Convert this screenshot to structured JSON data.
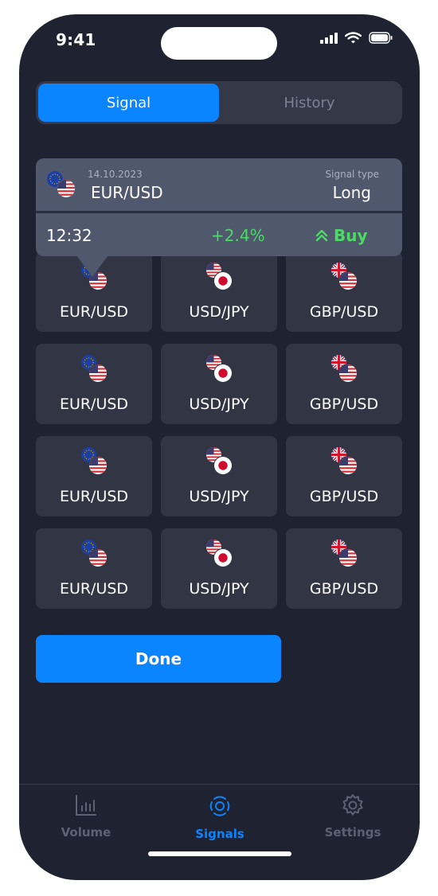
{
  "status_bar": {
    "time": "9:41"
  },
  "segments": [
    {
      "label": "Signal",
      "active": true
    },
    {
      "label": "History",
      "active": false
    }
  ],
  "signal_card": {
    "date": "14.10.2023",
    "pair": "EUR/USD",
    "type_label": "Signal type",
    "type": "Long",
    "time": "12:32",
    "change": "+2.4%",
    "action": "Buy"
  },
  "pairs": [
    {
      "label": "EUR/USD",
      "base": "eu",
      "quote": "us"
    },
    {
      "label": "USD/JPY",
      "base": "us",
      "quote": "jp"
    },
    {
      "label": "GBP/USD",
      "base": "gb",
      "quote": "us"
    },
    {
      "label": "EUR/USD",
      "base": "eu",
      "quote": "us"
    },
    {
      "label": "USD/JPY",
      "base": "us",
      "quote": "jp"
    },
    {
      "label": "GBP/USD",
      "base": "gb",
      "quote": "us"
    },
    {
      "label": "EUR/USD",
      "base": "eu",
      "quote": "us"
    },
    {
      "label": "USD/JPY",
      "base": "us",
      "quote": "jp"
    },
    {
      "label": "GBP/USD",
      "base": "gb",
      "quote": "us"
    },
    {
      "label": "EUR/USD",
      "base": "eu",
      "quote": "us"
    },
    {
      "label": "USD/JPY",
      "base": "us",
      "quote": "jp"
    },
    {
      "label": "GBP/USD",
      "base": "gb",
      "quote": "us"
    }
  ],
  "done_label": "Done",
  "tabs": [
    {
      "label": "Volume",
      "icon": "bar-chart-icon",
      "active": false
    },
    {
      "label": "Signals",
      "icon": "signal-broadcast-icon",
      "active": true
    },
    {
      "label": "Settings",
      "icon": "gear-icon",
      "active": false
    }
  ],
  "colors": {
    "background": "#1f2230",
    "card": "#323543",
    "accent": "#0a84ff",
    "positive": "#4cd964",
    "inactive": "#5c6173"
  }
}
